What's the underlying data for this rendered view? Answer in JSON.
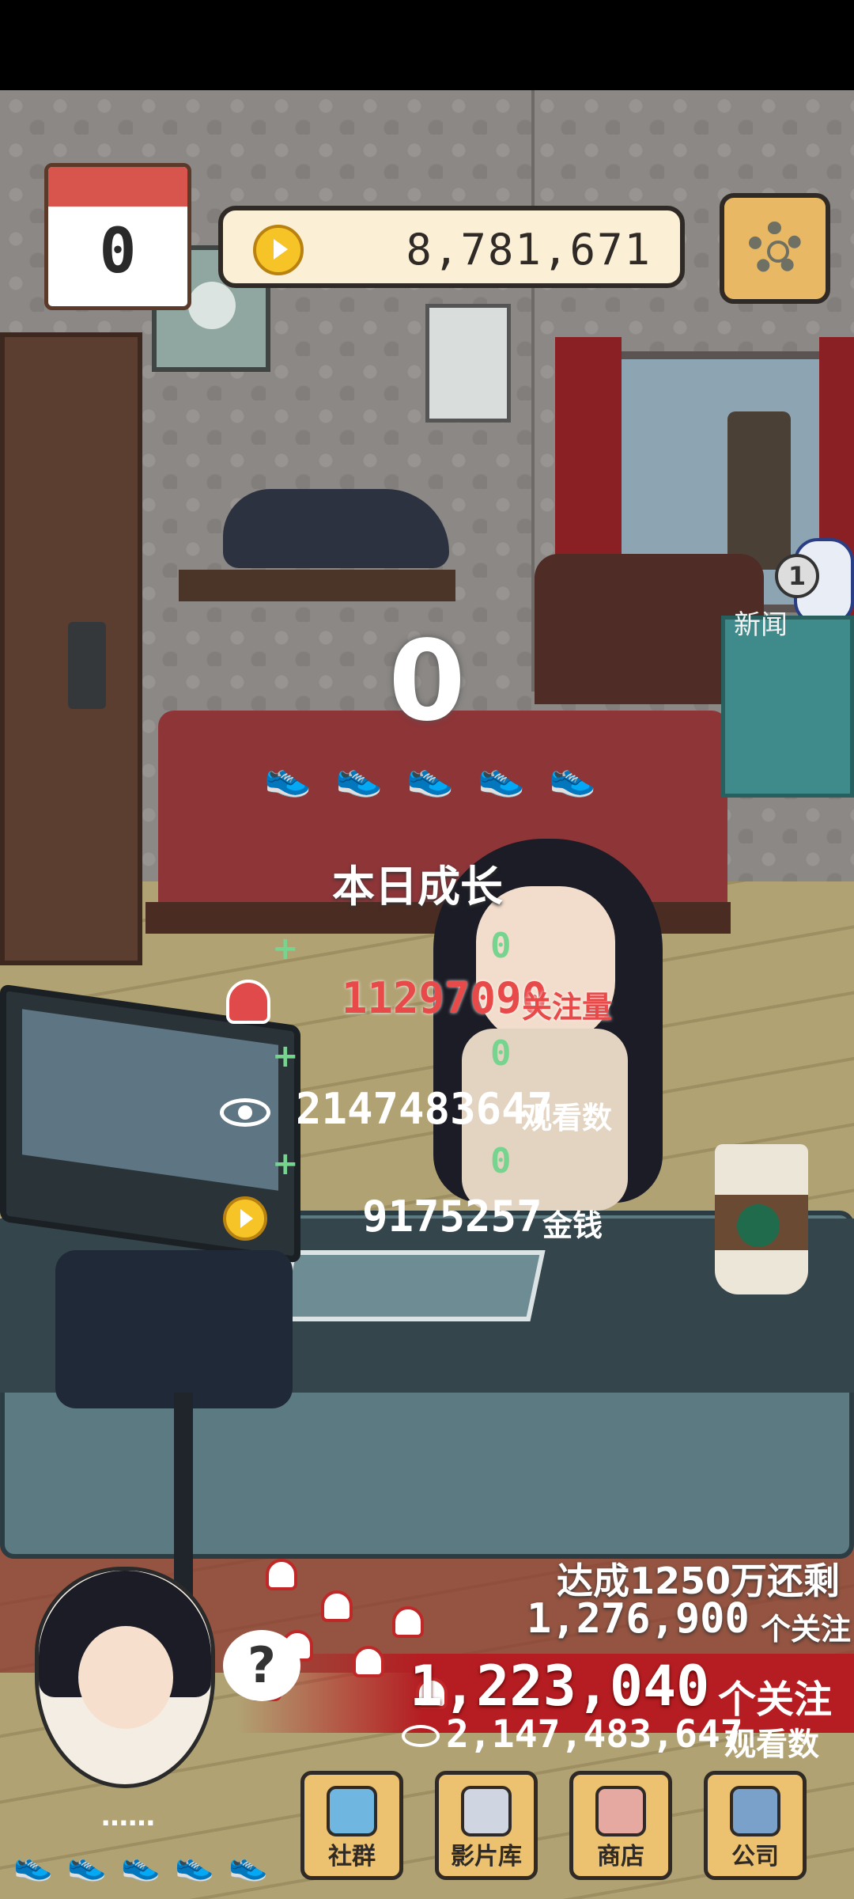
{
  "hud": {
    "day_counter": "0",
    "coins": "8,781,671",
    "settings_icon": "gear-icon",
    "coin_icon": "coin-icon"
  },
  "news": {
    "badge_count": "1",
    "label": "新闻"
  },
  "scene": {
    "center_counter": "0"
  },
  "daily_growth": {
    "title": "本日成长",
    "plus_sign": "+",
    "followers": {
      "delta": "0",
      "value": "11297090",
      "label": "关注量",
      "icon": "bell-icon"
    },
    "views": {
      "delta": "0",
      "value": "2147483647",
      "label": "观看数",
      "icon": "eye-icon"
    },
    "money": {
      "delta": "0",
      "value": "9175257",
      "label": "金钱",
      "icon": "coin-icon"
    }
  },
  "goal": {
    "line1": "达成1250万还剩",
    "remaining": "1,276,900",
    "remaining_unit": "个关注",
    "followers_total": "1,223,040",
    "followers_unit": "个关注",
    "views_total": "2,147,483,647",
    "views_unit": "观看数"
  },
  "character": {
    "status_text": "……",
    "question_mark": "?"
  },
  "stamina": {
    "count": 5
  },
  "nav": {
    "community": {
      "label": "社群",
      "icon": "community-icon"
    },
    "film_library": {
      "label": "影片库",
      "icon": "film-library-icon"
    },
    "shop": {
      "label": "商店",
      "icon": "shop-icon"
    },
    "company": {
      "label": "公司",
      "icon": "company-icon"
    }
  },
  "colors": {
    "accent_red": "#b51d22",
    "gain_green": "#77d48f",
    "coin_gold": "#f7c428",
    "button_tan": "#ecc16f"
  }
}
